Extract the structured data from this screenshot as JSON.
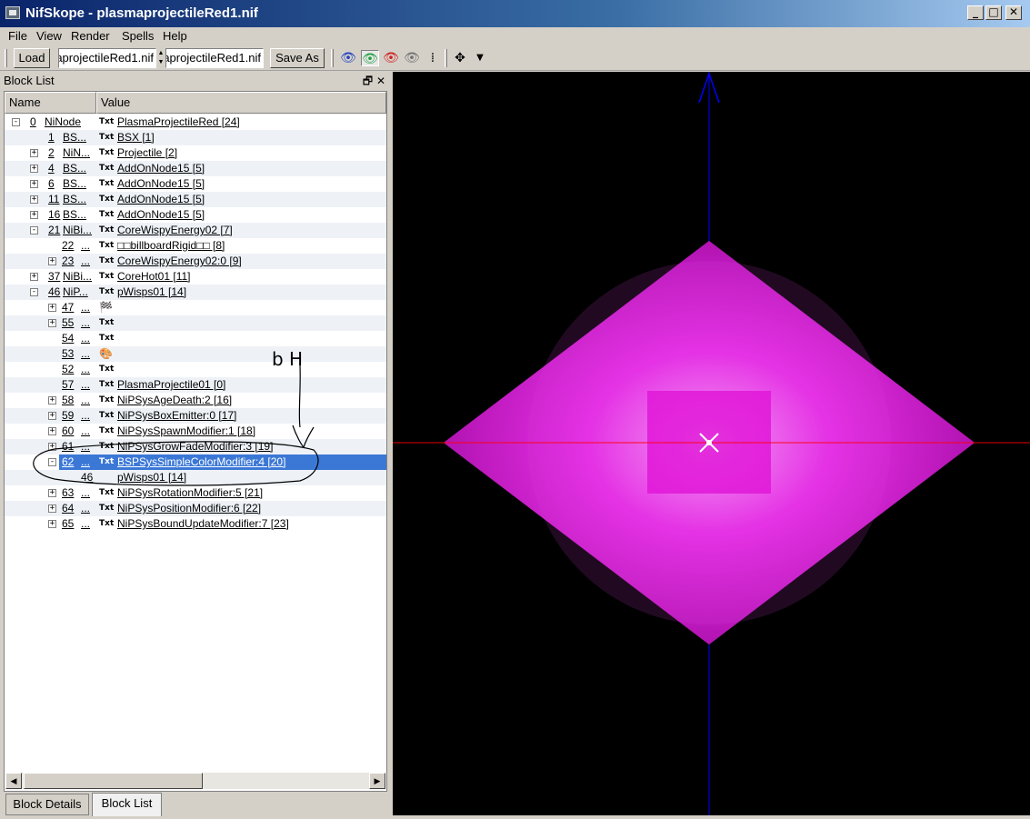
{
  "window": {
    "title": "NifSkope - plasmaprojectileRed1.nif",
    "minimize": "_",
    "maximize": "□",
    "close": "✕"
  },
  "menu": [
    "File",
    "View",
    "Render",
    "Spells",
    "Help"
  ],
  "toolbar": {
    "load_label": "Load",
    "file_field_1": "aprojectileRed1.nif",
    "file_field_2": "aprojectileRed1.nif",
    "save_as_label": "Save As",
    "icons": [
      "eye-blue-icon",
      "eye-green-icon",
      "eye-red-icon",
      "eye-gray-icon",
      "footprints-icon",
      "move-icon",
      "dropdown-arrow-icon"
    ]
  },
  "dock": {
    "title": "Block List",
    "float_btn": "🗗",
    "close_btn": "✕"
  },
  "tree": {
    "columns": [
      "Name",
      "Value"
    ],
    "rows": [
      {
        "depth": 0,
        "num": "0",
        "name": "NiNode",
        "icon": "Txt",
        "value": "PlasmaProjectileRed [24]",
        "expander": "-"
      },
      {
        "depth": 1,
        "num": "1",
        "name": "BS...",
        "icon": "Txt",
        "value": "BSX [1]",
        "expander": ""
      },
      {
        "depth": 1,
        "num": "2",
        "name": "NiN...",
        "icon": "Txt",
        "value": "Projectile [2]",
        "expander": "+"
      },
      {
        "depth": 1,
        "num": "4",
        "name": "BS...",
        "icon": "Txt",
        "value": "AddOnNode15 [5]",
        "expander": "+"
      },
      {
        "depth": 1,
        "num": "6",
        "name": "BS...",
        "icon": "Txt",
        "value": "AddOnNode15 [5]",
        "expander": "+"
      },
      {
        "depth": 1,
        "num": "11",
        "name": "BS...",
        "icon": "Txt",
        "value": "AddOnNode15 [5]",
        "expander": "+"
      },
      {
        "depth": 1,
        "num": "16",
        "name": "BS...",
        "icon": "Txt",
        "value": "AddOnNode15 [5]",
        "expander": "+"
      },
      {
        "depth": 1,
        "num": "21",
        "name": "NiBi...",
        "icon": "Txt",
        "value": "CoreWispyEnergy02 [7]",
        "expander": "-"
      },
      {
        "depth": 2,
        "num": "22",
        "name": "...",
        "icon": "Txt",
        "value": "□□billboardRigid□□ [8]",
        "expander": ""
      },
      {
        "depth": 2,
        "num": "23",
        "name": "...",
        "icon": "Txt",
        "value": "CoreWispyEnergy02:0 [9]",
        "expander": "+"
      },
      {
        "depth": 1,
        "num": "37",
        "name": "NiBi...",
        "icon": "Txt",
        "value": "CoreHot01 [11]",
        "expander": "+"
      },
      {
        "depth": 1,
        "num": "46",
        "name": "NiP...",
        "icon": "Txt",
        "value": "pWisps01 [14]",
        "expander": "-"
      },
      {
        "depth": 2,
        "num": "47",
        "name": "...",
        "icon": "flag-icon",
        "value": "",
        "expander": "+"
      },
      {
        "depth": 2,
        "num": "55",
        "name": "...",
        "icon": "Txt",
        "value": "",
        "expander": "+"
      },
      {
        "depth": 2,
        "num": "54",
        "name": "...",
        "icon": "Txt",
        "value": "",
        "expander": ""
      },
      {
        "depth": 2,
        "num": "53",
        "name": "...",
        "icon": "palette-icon",
        "value": "",
        "expander": ""
      },
      {
        "depth": 2,
        "num": "52",
        "name": "...",
        "icon": "Txt",
        "value": "",
        "expander": ""
      },
      {
        "depth": 2,
        "num": "57",
        "name": "...",
        "icon": "Txt",
        "value": "PlasmaProjectile01 [0]",
        "expander": ""
      },
      {
        "depth": 2,
        "num": "58",
        "name": "...",
        "icon": "Txt",
        "value": "NiPSysAgeDeath:2 [16]",
        "expander": "+"
      },
      {
        "depth": 2,
        "num": "59",
        "name": "...",
        "icon": "Txt",
        "value": "NiPSysBoxEmitter:0 [17]",
        "expander": "+"
      },
      {
        "depth": 2,
        "num": "60",
        "name": "...",
        "icon": "Txt",
        "value": "NiPSysSpawnModifier:1 [18]",
        "expander": "+"
      },
      {
        "depth": 2,
        "num": "61",
        "name": "...",
        "icon": "Txt",
        "value": "NiPSysGrowFadeModifier:3 [19]",
        "expander": "+"
      },
      {
        "depth": 2,
        "num": "62",
        "name": "...",
        "icon": "Txt",
        "value": "BSPSysSimpleColorModifier:4 [20]",
        "expander": "-",
        "selected": true
      },
      {
        "depth": 3,
        "num": "46",
        "name": "",
        "icon": "",
        "value": "pWisps01 [14]",
        "expander": ""
      },
      {
        "depth": 2,
        "num": "63",
        "name": "...",
        "icon": "Txt",
        "value": "NiPSysRotationModifier:5 [21]",
        "expander": "+"
      },
      {
        "depth": 2,
        "num": "64",
        "name": "...",
        "icon": "Txt",
        "value": "NiPSysPositionModifier:6 [22]",
        "expander": "+"
      },
      {
        "depth": 2,
        "num": "65",
        "name": "...",
        "icon": "Txt",
        "value": "NiPSysBoundUpdateModifier:7 [23]",
        "expander": "+"
      }
    ]
  },
  "tabs": [
    "Block Details",
    "Block List"
  ],
  "active_tab": "Block List",
  "annotation_text": "b H",
  "colors": {
    "selection": "#3b78d6",
    "viewport_bg": "#000000",
    "magenta": "#e020e0",
    "axis_x": "#ff0000",
    "axis_y": "#0000ff"
  }
}
